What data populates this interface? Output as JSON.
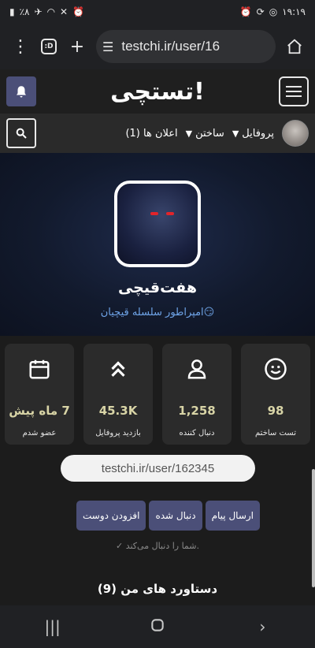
{
  "status_bar": {
    "battery": "٪۸",
    "time": "۱۹:۱۹"
  },
  "browser": {
    "tab_count": ":D",
    "url": "testchi.ir/user/16"
  },
  "site": {
    "logo": "تستچی!"
  },
  "nav": {
    "profile": "پروفایل",
    "build": "ساختن",
    "notifications": "اعلان ها (1)"
  },
  "profile": {
    "name": "هفت‌قیچی",
    "tagline": "امپراطور سلسله قیچیان😏"
  },
  "stats": [
    {
      "value": "98",
      "label": "تست ساختم",
      "icon": "smiley-icon"
    },
    {
      "value": "1,258",
      "label": "دنبال کننده",
      "icon": "user-icon"
    },
    {
      "value": "45.3K",
      "label": "بازدید پروفایل",
      "icon": "chevrons-up-icon"
    },
    {
      "value": "7 ماه پیش",
      "label": "عضو شدم",
      "icon": "calendar-icon"
    }
  ],
  "profile_url": "testchi.ir/user/162345",
  "actions": {
    "send_message": "ارسال پیام",
    "followed": "دنبال شده",
    "add_friend": "افزودن دوست"
  },
  "follows_you": "✓ شما را دنبال می‌کند.",
  "achievements_title": "دستاورد های من (9)"
}
